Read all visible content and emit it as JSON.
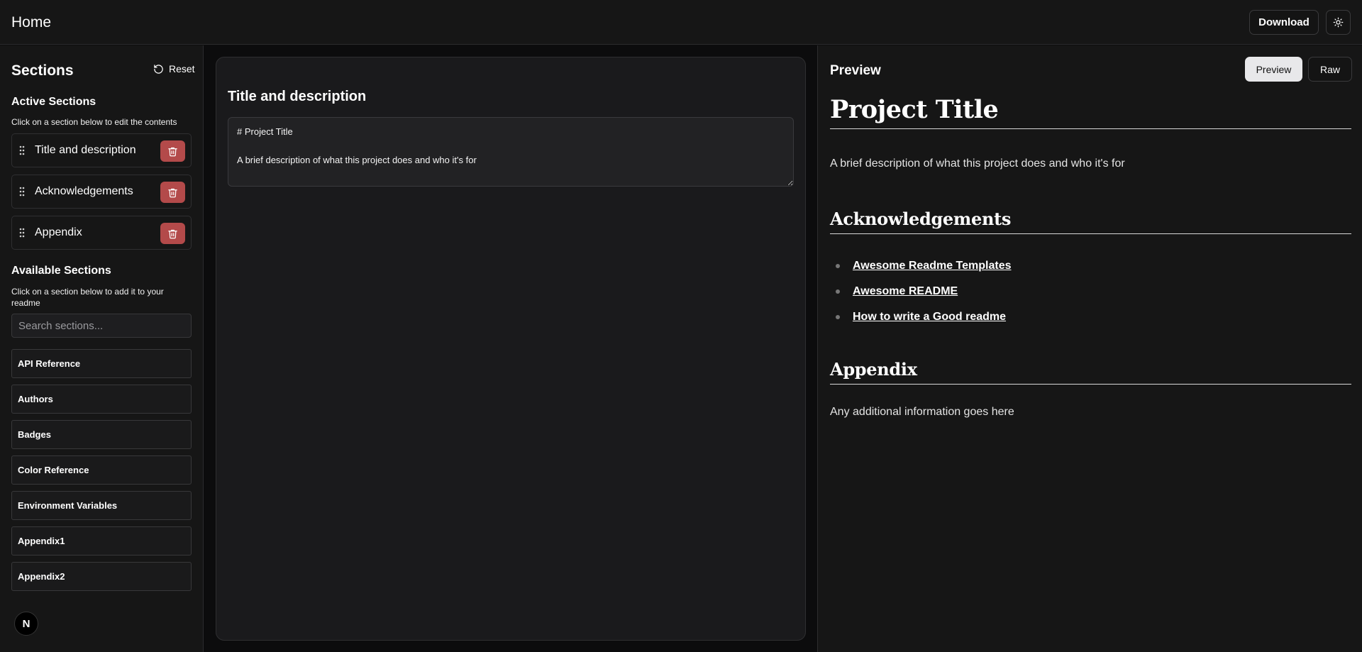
{
  "header": {
    "title": "Home",
    "download_label": "Download",
    "theme_icon": "sun-icon"
  },
  "sidebar": {
    "title": "Sections",
    "reset_label": "Reset",
    "active": {
      "heading": "Active Sections",
      "hint": "Click on a section below to edit the contents",
      "items": [
        {
          "label": "Title and description"
        },
        {
          "label": "Acknowledgements"
        },
        {
          "label": "Appendix"
        }
      ]
    },
    "available": {
      "heading": "Available Sections",
      "hint": "Click on a section below to add it to your readme",
      "search_placeholder": "Search sections...",
      "items": [
        {
          "label": "API Reference"
        },
        {
          "label": "Authors"
        },
        {
          "label": "Badges"
        },
        {
          "label": "Color Reference"
        },
        {
          "label": "Environment Variables"
        },
        {
          "label": "Appendix1"
        },
        {
          "label": "Appendix2"
        }
      ]
    },
    "badge_letter": "N"
  },
  "editor": {
    "title": "Title and description",
    "content": "# Project Title\n\nA brief description of what this project does and who it's for"
  },
  "preview": {
    "label": "Preview",
    "mode_preview": "Preview",
    "mode_raw": "Raw",
    "h1": "Project Title",
    "intro": "A brief description of what this project does and who it's for",
    "ack_heading": "Acknowledgements",
    "ack_links": [
      "Awesome Readme Templates",
      "Awesome README",
      "How to write a Good readme"
    ],
    "appendix_heading": "Appendix",
    "appendix_text": "Any additional information goes here"
  },
  "colors": {
    "background": "#0c0c0d",
    "panel": "#161616",
    "delete_button": "#b34a4a",
    "active_toggle": "#e8e8ea"
  }
}
